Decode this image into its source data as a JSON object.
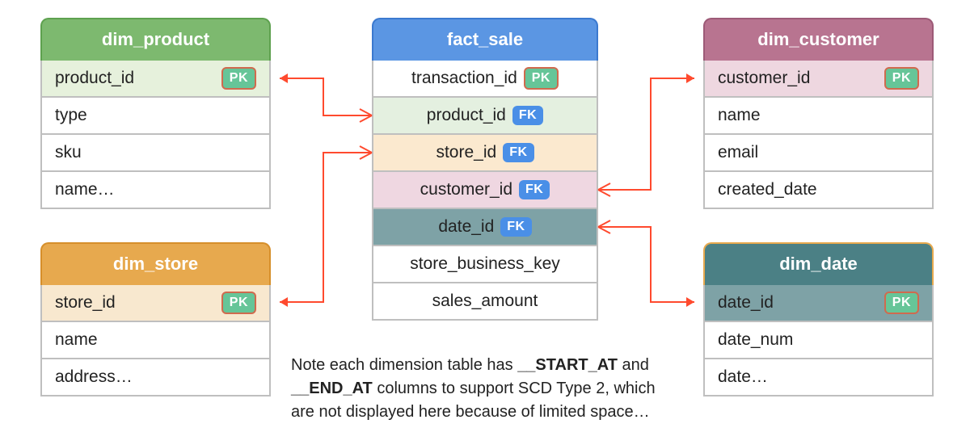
{
  "tables": {
    "dim_product": {
      "title": "dim_product",
      "cols": [
        {
          "name": "product_id",
          "key": "PK"
        },
        {
          "name": "type"
        },
        {
          "name": "sku"
        },
        {
          "name": "name…"
        }
      ]
    },
    "fact_sale": {
      "title": "fact_sale",
      "cols": [
        {
          "name": "transaction_id",
          "key": "PK"
        },
        {
          "name": "product_id",
          "key": "FK"
        },
        {
          "name": "store_id",
          "key": "FK"
        },
        {
          "name": "customer_id",
          "key": "FK"
        },
        {
          "name": "date_id",
          "key": "FK"
        },
        {
          "name": "store_business_key"
        },
        {
          "name": "sales_amount"
        }
      ]
    },
    "dim_customer": {
      "title": "dim_customer",
      "cols": [
        {
          "name": "customer_id",
          "key": "PK"
        },
        {
          "name": "name"
        },
        {
          "name": "email"
        },
        {
          "name": "created_date"
        }
      ]
    },
    "dim_store": {
      "title": "dim_store",
      "cols": [
        {
          "name": "store_id",
          "key": "PK"
        },
        {
          "name": "name"
        },
        {
          "name": "address…"
        }
      ]
    },
    "dim_date": {
      "title": "dim_date",
      "cols": [
        {
          "name": "date_id",
          "key": "PK"
        },
        {
          "name": "date_num"
        },
        {
          "name": "date…"
        }
      ]
    }
  },
  "footnote": {
    "prefix": "Note each dimension table has ",
    "b1": "__START_AT",
    "mid": " and ",
    "b2": "__END_AT",
    "suffix": " columns to support SCD Type 2, which are not displayed here because of limited space…"
  },
  "relationships": [
    {
      "from": "fact_sale.product_id",
      "to": "dim_product.product_id"
    },
    {
      "from": "fact_sale.store_id",
      "to": "dim_store.store_id"
    },
    {
      "from": "fact_sale.customer_id",
      "to": "dim_customer.customer_id"
    },
    {
      "from": "fact_sale.date_id",
      "to": "dim_date.date_id"
    }
  ],
  "colors": {
    "green": "#7db96f",
    "blue": "#5b96e3",
    "rose": "#b87490",
    "orange": "#e7a94e",
    "teal": "#4b8085",
    "connector": "#ff4a2e",
    "pk_badge": "#66c598",
    "fk_badge": "#4a8fe7"
  }
}
